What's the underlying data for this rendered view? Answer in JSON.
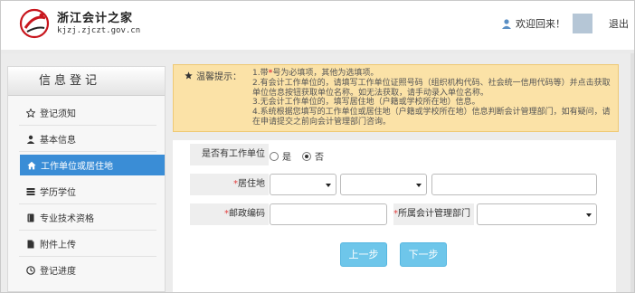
{
  "header": {
    "site_name": "浙江会计之家",
    "site_url": "kjzj.zjczt.gov.cn",
    "welcome": "欢迎回来！",
    "logout": "退出"
  },
  "sidebar": {
    "title": "信息登记",
    "items": [
      {
        "label": "登记须知",
        "icon": "star-outline-icon"
      },
      {
        "label": "基本信息",
        "icon": "user-icon"
      },
      {
        "label": "工作单位或居住地",
        "icon": "home-icon",
        "active": true
      },
      {
        "label": "学历学位",
        "icon": "list-icon"
      },
      {
        "label": "专业技术资格",
        "icon": "book-icon"
      },
      {
        "label": "附件上传",
        "icon": "file-icon"
      },
      {
        "label": "登记进度",
        "icon": "clock-icon"
      }
    ]
  },
  "notice": {
    "label": "温馨提示：",
    "line1_pre": "1.带",
    "line1_star": "*",
    "line1_post": "号为必填项，其他为选填项。",
    "line2": "2.有会计工作单位的，请填写工作单位证照号码（组织机构代码、社会统一信用代码等）并点击获取单位信息按钮获取单位名称。如无法获取，请手动录入单位名称。",
    "line3": "3.无会计工作单位的，填写居住地（户籍或学校所在地）信息。",
    "line4": "4.系统根据您填写的工作单位或居住地（户籍或学校所在地）信息判断会计管理部门，如有疑问，请在申请提交之前向会计管理部门咨询。"
  },
  "form": {
    "has_employer_label": "是否有工作单位",
    "option_yes": "是",
    "option_no": "否",
    "selected": "否",
    "residence_label": "居住地",
    "postcode_label": "邮政编码",
    "dept_label": "所属会计管理部门",
    "required_mark": "*",
    "prev_button": "上一步",
    "next_button": "下一步"
  },
  "colors": {
    "accent": "#3a8dd6",
    "notice_bg": "#fbe2a7",
    "button_bg": "#6ec6ea",
    "required": "#e23d3d"
  }
}
